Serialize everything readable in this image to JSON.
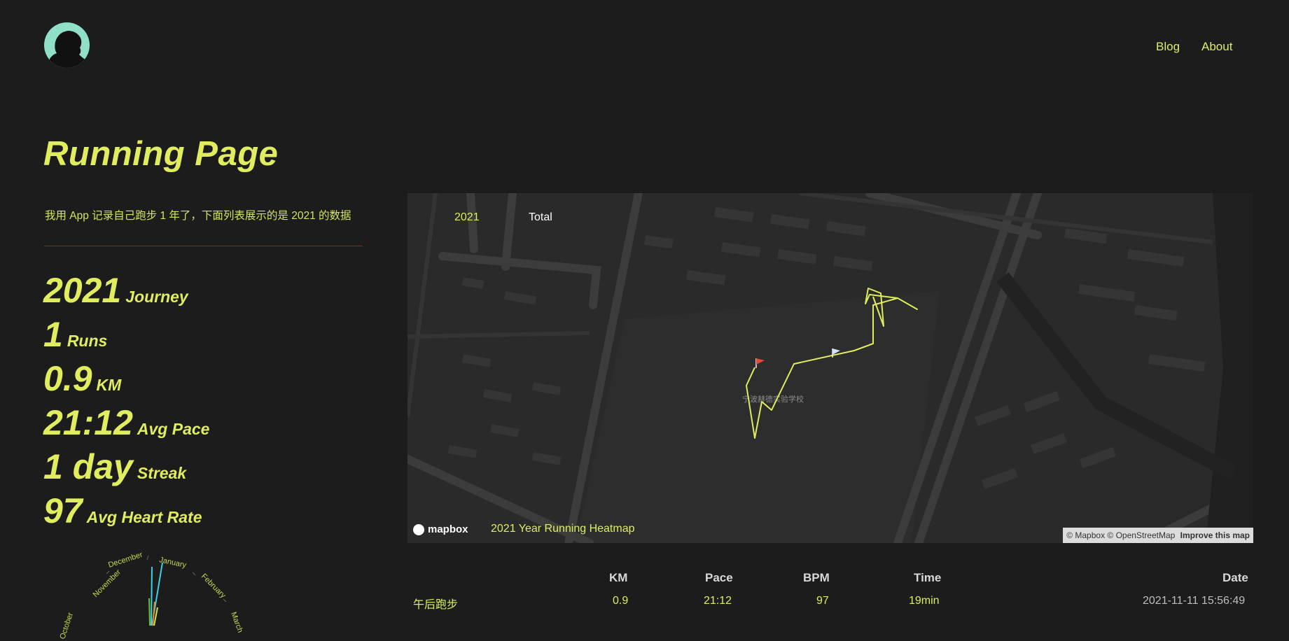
{
  "header": {
    "avatar_label": "avatar",
    "nav": [
      {
        "label": "Blog"
      },
      {
        "label": "About"
      }
    ]
  },
  "title": "Running Page",
  "intro": "我用 App 记录自己跑步 1 年了，下面列表展示的是 2021 的数据",
  "stats": [
    {
      "value": "2021",
      "label": "Journey"
    },
    {
      "value": "1",
      "label": "Runs"
    },
    {
      "value": "0.9",
      "label": "KM"
    },
    {
      "value": "21:12",
      "label": "Avg Pace"
    },
    {
      "value": "1 day",
      "label": "Streak"
    },
    {
      "value": "97",
      "label": "Avg Heart Rate"
    }
  ],
  "map": {
    "year_tabs": [
      "2021",
      "Total"
    ],
    "caption": "2021 Year Running Heatmap",
    "logo": "mapbox",
    "attribution": "© Mapbox © OpenStreetMap",
    "improve": "Improve this map",
    "school_label": "宁波赫德实验学校"
  },
  "calendar": {
    "months": [
      "October",
      "November",
      "December",
      "January",
      "February",
      "March"
    ]
  },
  "table": {
    "headers": [
      "KM",
      "Pace",
      "BPM",
      "Time",
      "Date"
    ],
    "rows": [
      {
        "name": "午后跑步",
        "km": "0.9",
        "pace": "21:12",
        "bpm": "97",
        "time": "19min",
        "date": "2021-11-11 15:56:49"
      }
    ]
  },
  "colors": {
    "accent": "#e0ed5e",
    "background": "#1c1c1c",
    "map_bg": "#2a2a2a",
    "divider": "#8a2a20",
    "route": "#e0ed5e"
  }
}
